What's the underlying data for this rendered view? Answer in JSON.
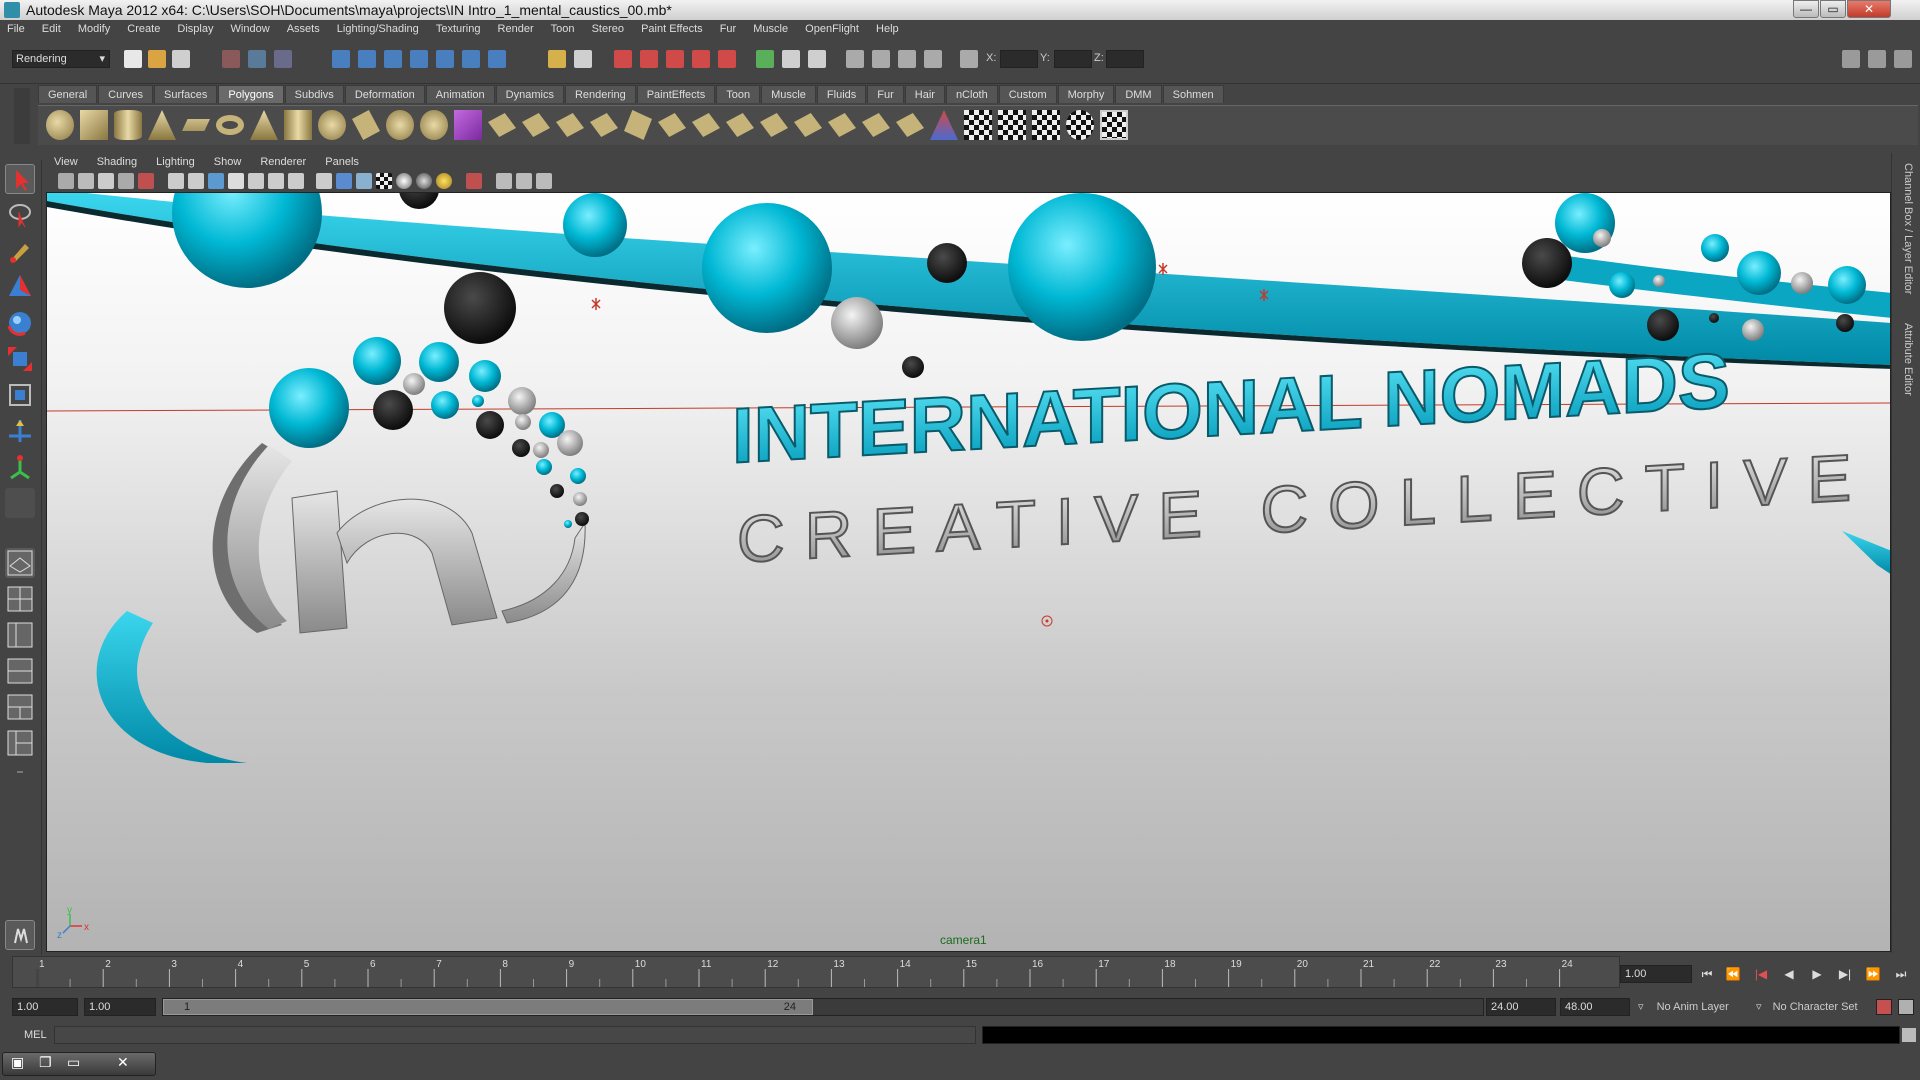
{
  "window": {
    "title": "Autodesk Maya 2012 x64: C:\\Users\\SOH\\Documents\\maya\\projects\\IN Intro_1_mental_caustics_00.mb*",
    "minimize": "—",
    "maximize": "▭",
    "close": "✕"
  },
  "menubar": {
    "items": [
      "File",
      "Edit",
      "Modify",
      "Create",
      "Display",
      "Window",
      "Assets",
      "Lighting/Shading",
      "Texturing",
      "Render",
      "Toon",
      "Stereo",
      "Paint Effects",
      "Fur",
      "Muscle",
      "OpenFlight",
      "Help"
    ]
  },
  "statusline": {
    "menuset": "Rendering",
    "x_label": "X:",
    "y_label": "Y:",
    "z_label": "Z:"
  },
  "shelf": {
    "tabs": [
      "General",
      "Curves",
      "Surfaces",
      "Polygons",
      "Subdivs",
      "Deformation",
      "Animation",
      "Dynamics",
      "Rendering",
      "PaintEffects",
      "Toon",
      "Muscle",
      "Fluids",
      "Fur",
      "Hair",
      "nCloth",
      "Custom",
      "Morphy",
      "DMM",
      "Sohmen"
    ],
    "active_tab": "Polygons"
  },
  "panel_menu": {
    "items": [
      "View",
      "Shading",
      "Lighting",
      "Show",
      "Renderer",
      "Panels"
    ]
  },
  "viewport": {
    "camera": "camera1",
    "title_line1": "INTERNATIONAL NOMADS",
    "title_line2": "CREATIVE COLLECTIVE",
    "axis_x": "x",
    "axis_y": "y",
    "axis_z": "z"
  },
  "right_tabs": {
    "channel_box": "Channel Box / Layer Editor",
    "attribute_editor": "Attribute Editor"
  },
  "timeline": {
    "ticks": [
      "1",
      "2",
      "3",
      "4",
      "5",
      "6",
      "7",
      "8",
      "9",
      "10",
      "11",
      "12",
      "13",
      "14",
      "15",
      "16",
      "17",
      "18",
      "19",
      "20",
      "21",
      "22",
      "23",
      "24"
    ],
    "current_time": "1.00"
  },
  "playback": {
    "buttons": [
      "⏮",
      "⏪",
      "|◀",
      "◀",
      "▶",
      "▶|",
      "⏩",
      "⏭"
    ]
  },
  "range": {
    "start_time": "1.00",
    "playback_start": "1.00",
    "handle_start": "1",
    "handle_end": "24",
    "playback_end": "24.00",
    "end_time": "48.00",
    "anim_layer": "No Anim Layer",
    "character_set": "No Character Set"
  },
  "cmdline": {
    "language": "MEL"
  },
  "colors": {
    "cyan": "#00b8d4",
    "cyan_dark": "#006f86",
    "dark_sphere": "#1c1c1c",
    "grey_sphere": "#bdbdbd"
  }
}
